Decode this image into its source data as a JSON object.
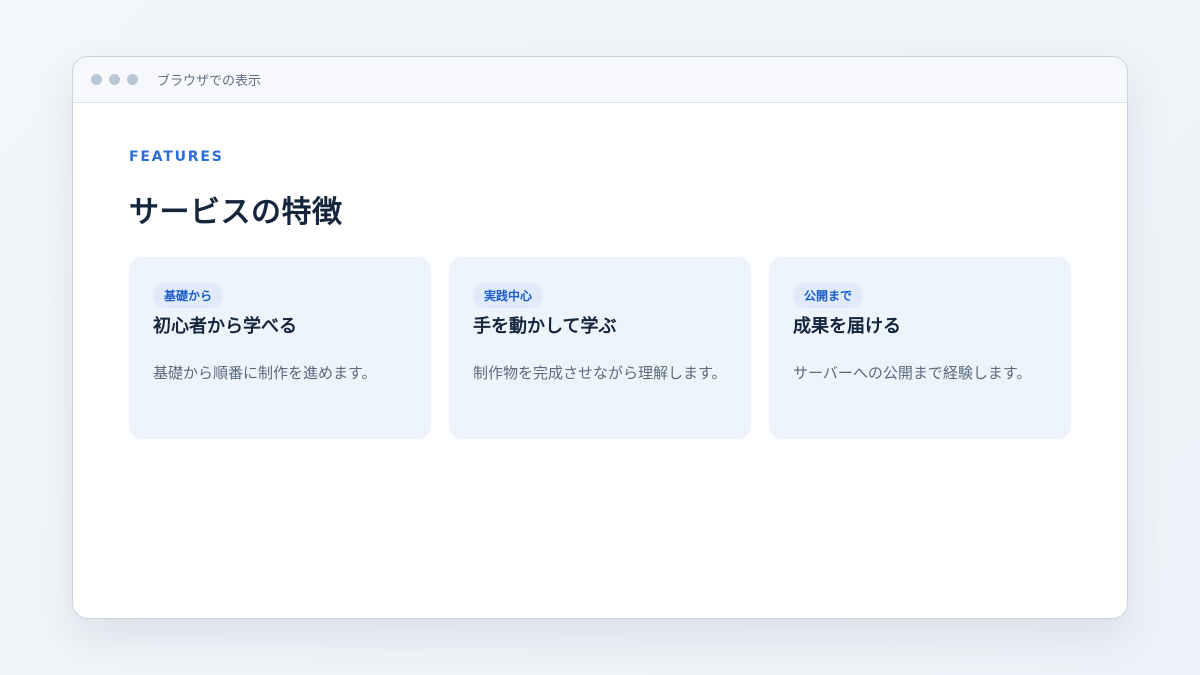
{
  "window": {
    "title": "ブラウザでの表示"
  },
  "section": {
    "eyebrow": "FEATURES",
    "heading": "サービスの特徴"
  },
  "cards": [
    {
      "badge": "基礎から",
      "title": "初心者から学べる",
      "text": "基礎から順番に制作を進めます。"
    },
    {
      "badge": "実践中心",
      "title": "手を動かして学ぶ",
      "text": "制作物を完成させながら理解します。"
    },
    {
      "badge": "公開まで",
      "title": "成果を届ける",
      "text": "サーバーへの公開まで経験します。"
    }
  ],
  "colors": {
    "accent": "#2b6fd6",
    "heading": "#14253c",
    "card_bg": "#eef4fc",
    "badge_bg": "#dfeafb",
    "body_text": "#5b6b7d"
  }
}
